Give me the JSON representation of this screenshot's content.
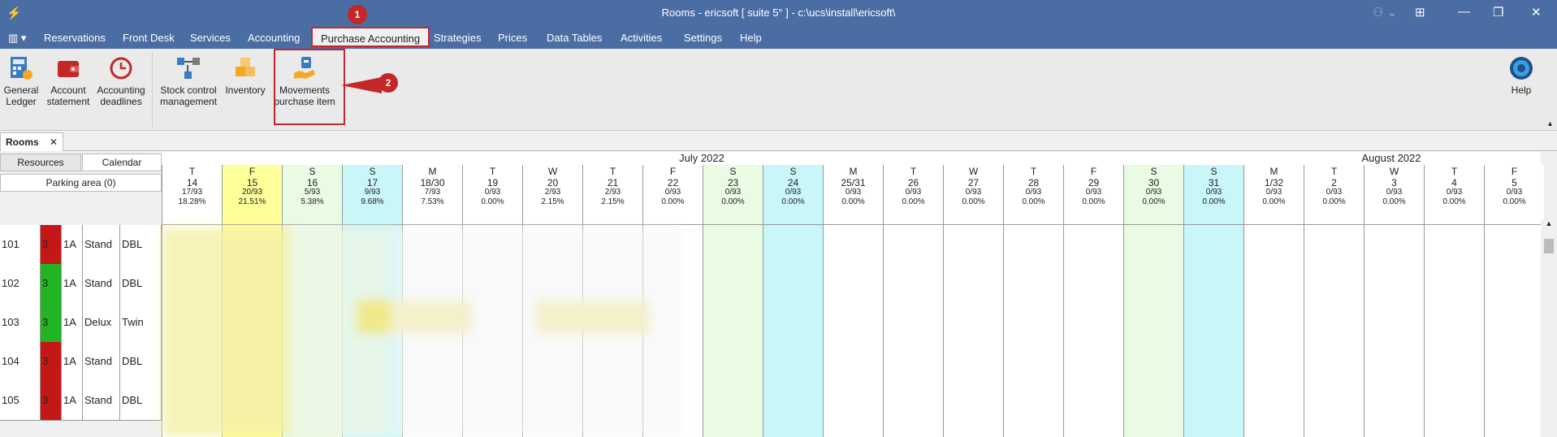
{
  "window": {
    "title": "Rooms - ericsoft [ suite 5° ] - c:\\ucs\\install\\ericsoft\\"
  },
  "menu": [
    "Reservations",
    "Front Desk",
    "Services",
    "Accounting",
    "Purchase Accounting",
    "Strategies",
    "Prices",
    "Data Tables",
    "Activities",
    "Settings",
    "Help"
  ],
  "ribbon": {
    "general_ledger": "General Ledger",
    "account_statement": "Account statement",
    "accounting_deadlines": "Accounting deadlines",
    "stock_control": "Stock control management",
    "inventory": "Inventory",
    "movements": "Movements purchase item",
    "help": "Help"
  },
  "badges": [
    "1",
    "2"
  ],
  "doc_tab": "Rooms",
  "left_panel": {
    "resources": "Resources",
    "calendar": "Calendar",
    "parking": "Parking area (0)"
  },
  "months": [
    "July 2022",
    "August 2022"
  ],
  "days": [
    {
      "d": "T",
      "n": "14",
      "o": "17/93",
      "p": "18.28%"
    },
    {
      "d": "F",
      "n": "15",
      "o": "20/93",
      "p": "21.51%"
    },
    {
      "d": "S",
      "n": "16",
      "o": "5/93",
      "p": "5.38%"
    },
    {
      "d": "S",
      "n": "17",
      "o": "9/93",
      "p": "9.68%"
    },
    {
      "d": "M",
      "n": "18/30",
      "o": "7/93",
      "p": "7.53%"
    },
    {
      "d": "T",
      "n": "19",
      "o": "0/93",
      "p": "0.00%"
    },
    {
      "d": "W",
      "n": "20",
      "o": "2/93",
      "p": "2.15%"
    },
    {
      "d": "T",
      "n": "21",
      "o": "2/93",
      "p": "2.15%"
    },
    {
      "d": "F",
      "n": "22",
      "o": "0/93",
      "p": "0.00%"
    },
    {
      "d": "S",
      "n": "23",
      "o": "0/93",
      "p": "0.00%"
    },
    {
      "d": "S",
      "n": "24",
      "o": "0/93",
      "p": "0.00%"
    },
    {
      "d": "M",
      "n": "25/31",
      "o": "0/93",
      "p": "0.00%"
    },
    {
      "d": "T",
      "n": "26",
      "o": "0/93",
      "p": "0.00%"
    },
    {
      "d": "W",
      "n": "27",
      "o": "0/93",
      "p": "0.00%"
    },
    {
      "d": "T",
      "n": "28",
      "o": "0/93",
      "p": "0.00%"
    },
    {
      "d": "F",
      "n": "29",
      "o": "0/93",
      "p": "0.00%"
    },
    {
      "d": "S",
      "n": "30",
      "o": "0/93",
      "p": "0.00%"
    },
    {
      "d": "S",
      "n": "31",
      "o": "0/93",
      "p": "0.00%"
    },
    {
      "d": "M",
      "n": "1/32",
      "o": "0/93",
      "p": "0.00%"
    },
    {
      "d": "T",
      "n": "2",
      "o": "0/93",
      "p": "0.00%"
    },
    {
      "d": "W",
      "n": "3",
      "o": "0/93",
      "p": "0.00%"
    },
    {
      "d": "T",
      "n": "4",
      "o": "0/93",
      "p": "0.00%"
    },
    {
      "d": "F",
      "n": "5",
      "o": "0/93",
      "p": "0.00%"
    }
  ],
  "rooms": [
    {
      "num": "101",
      "floor": "3",
      "code": "1A",
      "type": "Stand",
      "bed": "DBL",
      "status": "#c41818"
    },
    {
      "num": "102",
      "floor": "3",
      "code": "1A",
      "type": "Stand",
      "bed": "DBL",
      "status": "#22b422"
    },
    {
      "num": "103",
      "floor": "3",
      "code": "1A",
      "type": "Delux",
      "bed": "Twin",
      "status": "#22b422"
    },
    {
      "num": "104",
      "floor": "3",
      "code": "1A",
      "type": "Stand",
      "bed": "DBL",
      "status": "#c41818"
    },
    {
      "num": "105",
      "floor": "3",
      "code": "1A",
      "type": "Stand",
      "bed": "DBL",
      "status": "#c41818"
    }
  ],
  "colors": {
    "titlebar": "#4a6ea3",
    "highlight": "#c0282d",
    "today": "#ffff99",
    "weekend_sat": "#eafbe3",
    "weekend_sun": "#c9f6f8"
  }
}
